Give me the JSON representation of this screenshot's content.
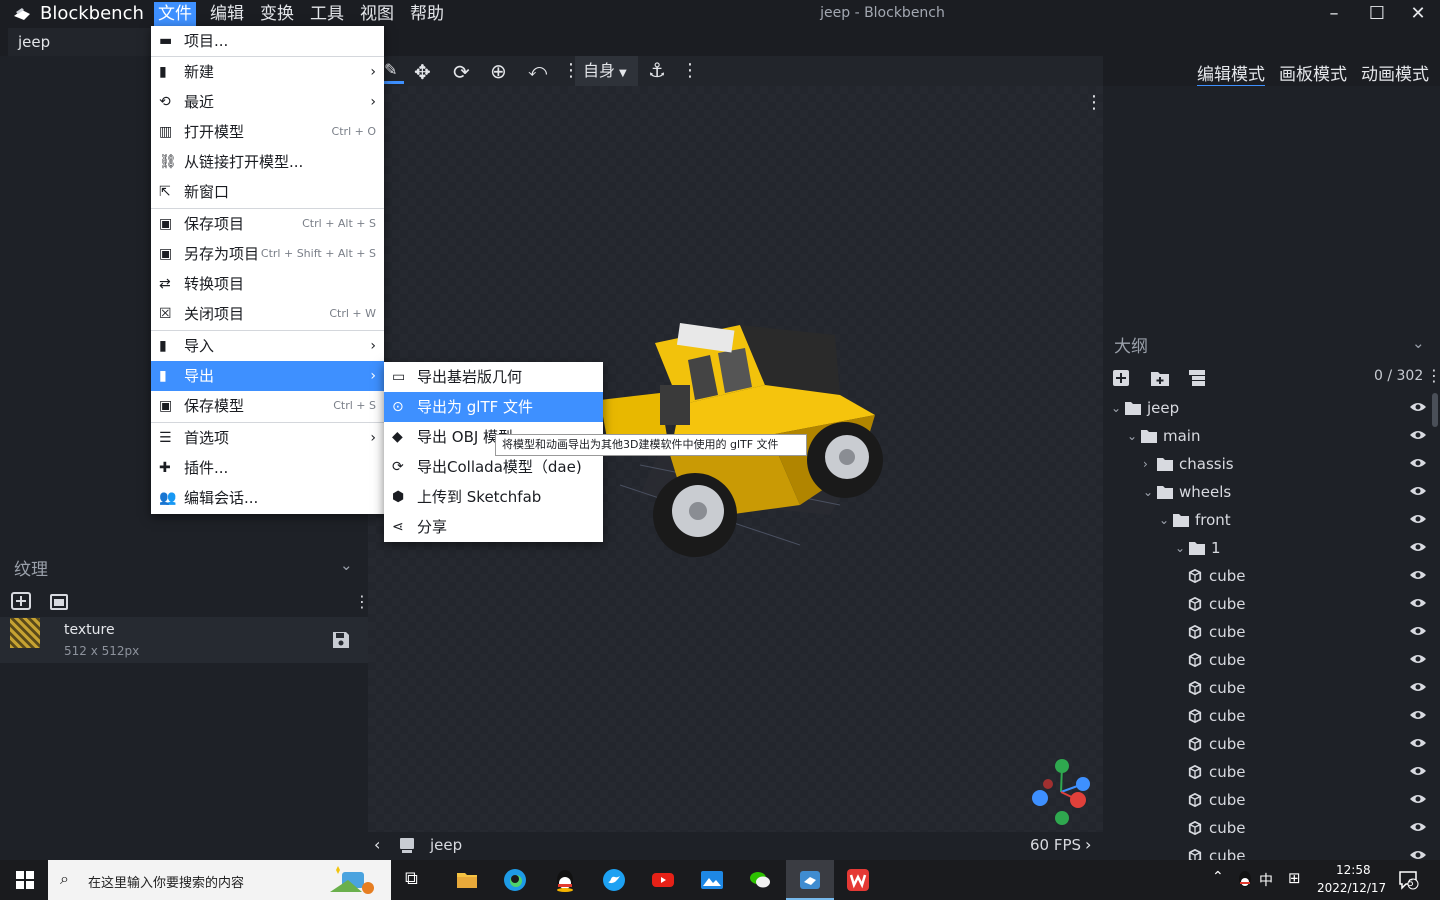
{
  "titlebar": {
    "app_name": "Blockbench",
    "window_title": "jeep - Blockbench",
    "menus": [
      "文件",
      "编辑",
      "变换",
      "工具",
      "视图",
      "帮助"
    ]
  },
  "tabs": [
    "jeep"
  ],
  "toolbar": {
    "space_label": "自身"
  },
  "modes": [
    "编辑模式",
    "画板模式",
    "动画模式"
  ],
  "file_menu": {
    "items": [
      {
        "label": "项目...",
        "shortcut": "",
        "submenu": false
      },
      {
        "label": "新建",
        "shortcut": "",
        "submenu": true
      },
      {
        "label": "最近",
        "shortcut": "",
        "submenu": true
      },
      {
        "label": "打开模型",
        "shortcut": "Ctrl + O",
        "submenu": false
      },
      {
        "label": "从链接打开模型...",
        "shortcut": "",
        "submenu": false
      },
      {
        "label": "新窗口",
        "shortcut": "",
        "submenu": false
      },
      {
        "label": "保存项目",
        "shortcut": "Ctrl + Alt + S",
        "submenu": false
      },
      {
        "label": "另存为项目",
        "shortcut": "Ctrl + Shift + Alt + S",
        "submenu": false
      },
      {
        "label": "转换项目",
        "shortcut": "",
        "submenu": false
      },
      {
        "label": "关闭项目",
        "shortcut": "Ctrl + W",
        "submenu": false
      },
      {
        "label": "导入",
        "shortcut": "",
        "submenu": true
      },
      {
        "label": "导出",
        "shortcut": "",
        "submenu": true
      },
      {
        "label": "保存模型",
        "shortcut": "Ctrl + S",
        "submenu": false
      },
      {
        "label": "首选项",
        "shortcut": "",
        "submenu": true
      },
      {
        "label": "插件...",
        "shortcut": "",
        "submenu": false
      },
      {
        "label": "编辑会话...",
        "shortcut": "",
        "submenu": false
      }
    ]
  },
  "export_menu": {
    "items": [
      "导出基岩版几何",
      "导出为 glTF 文件",
      "导出 OBJ 模型",
      "导出Collada模型（dae)",
      "上传到 Sketchfab",
      "分享"
    ],
    "tooltip": "将模型和动画导出为其他3D建模软件中使用的 glTF 文件"
  },
  "textures": {
    "header": "纹理",
    "items": [
      {
        "name": "texture",
        "size": "512 x 512px"
      }
    ]
  },
  "viewport": {
    "model_name": "jeep",
    "fps": "60 FPS"
  },
  "outliner": {
    "header": "大纲",
    "count": "0 / 302",
    "rows": [
      {
        "label": "jeep",
        "type": "group",
        "depth": 0,
        "open": true
      },
      {
        "label": "main",
        "type": "group",
        "depth": 1,
        "open": true
      },
      {
        "label": "chassis",
        "type": "group",
        "depth": 2,
        "open": false
      },
      {
        "label": "wheels",
        "type": "group",
        "depth": 2,
        "open": true
      },
      {
        "label": "front",
        "type": "group",
        "depth": 3,
        "open": true
      },
      {
        "label": "1",
        "type": "group",
        "depth": 4,
        "open": true
      },
      {
        "label": "cube",
        "type": "cube",
        "depth": 5
      },
      {
        "label": "cube",
        "type": "cube",
        "depth": 5
      },
      {
        "label": "cube",
        "type": "cube",
        "depth": 5
      },
      {
        "label": "cube",
        "type": "cube",
        "depth": 5
      },
      {
        "label": "cube",
        "type": "cube",
        "depth": 5
      },
      {
        "label": "cube",
        "type": "cube",
        "depth": 5
      },
      {
        "label": "cube",
        "type": "cube",
        "depth": 5
      },
      {
        "label": "cube",
        "type": "cube",
        "depth": 5
      },
      {
        "label": "cube",
        "type": "cube",
        "depth": 5
      },
      {
        "label": "cube",
        "type": "cube",
        "depth": 5
      },
      {
        "label": "cube",
        "type": "cube",
        "depth": 5
      }
    ]
  },
  "taskbar": {
    "search_placeholder": "在这里输入你要搜索的内容",
    "ime": "中",
    "time": "12:58",
    "date": "2022/12/17",
    "notifications": "5"
  },
  "colors": {
    "accent": "#3e90ff",
    "background": "#1e2127",
    "jeep_body": "#f2c20c"
  }
}
